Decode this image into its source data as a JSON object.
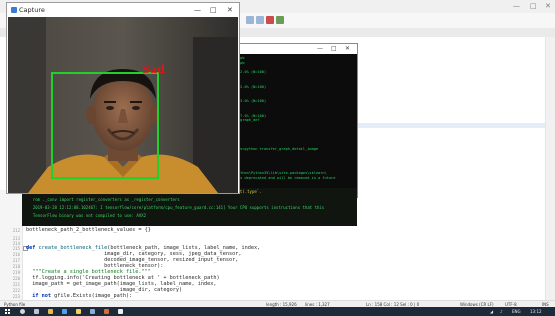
{
  "editor": {
    "window_controls": [
      "—",
      "□",
      "✕"
    ],
    "code_lines": [
      {
        "num": "212",
        "text": "bottleneck_path_2_bottleneck_values = {}"
      },
      {
        "num": "213",
        "text": ""
      },
      {
        "num": "214",
        "text": ""
      },
      {
        "num": "215",
        "kw": "def ",
        "fn": "create_bottleneck_file",
        "text": "(bottleneck_path, image_lists, label_name, index,"
      },
      {
        "num": "216",
        "text": "                         image_dir, category, sess, jpeg_data_tensor,"
      },
      {
        "num": "217",
        "text": "                         decoded_image_tensor, resized_input_tensor,"
      },
      {
        "num": "218",
        "text": "                         bottleneck_tensor):"
      },
      {
        "num": "219",
        "str": "  \"\"\"Create a single bottleneck file.\"\"\""
      },
      {
        "num": "220",
        "text": "  tf.logging.info('Creating bottleneck at ' + bottleneck_path)"
      },
      {
        "num": "221",
        "text": "  image_path = get_image_path(image_lists, label_name, index,"
      },
      {
        "num": "222",
        "text": "                              image_dir, category)"
      },
      {
        "num": "223",
        "kw": "  if not ",
        "text": "gfile.Exists(image_path):"
      }
    ]
  },
  "console": {
    "window_controls": [
      "—",
      "□",
      "✕"
    ],
    "lines": [
      ".pb",
      ".pb",
      "0",
      "52.0% (N=100)",
      "",
      "0",
      "62.0% (N=100)",
      "",
      "0",
      "63.0% (N=100)",
      "",
      "0",
      "77.0% (N=100)",
      "ngraph_def",
      "",
      "",
      "",
      "",
      "",
      "ws>python transfer_graph_detail_image",
      "",
      "",
      "",
      "",
      "ython\\Python35\\lib\\site-packages\\sklearn\\",
      "is deprecated and will be removed in a future",
      "",
      "",
      "",
      "",
      "",
      "",
      "",
      "label.py",
      "warnings: Conversion of the second argument of"
    ]
  },
  "output": {
    "lines": [
      "  floating` is deprecated. In future, it will be treated as `np.float64 == np.dtype(float).type`.",
      "  rom ._conv import register_converters as _register_converters",
      "  2019-03-28 12:12:08.102467: I tensorflow/core/platform/cpu_feature_guard.cc:141] Your CPU supports instructions that this",
      "  TensorFlow binary was not compiled to use: AVX2"
    ]
  },
  "capture": {
    "title": "Capture",
    "window_controls": [
      "—",
      "□",
      "✕"
    ],
    "emotion_label": "Sad"
  },
  "statusbar": {
    "left": "Python file",
    "length": "length : 15,926",
    "lines": "lines : 1,327",
    "position": "Ln : 158   Col : 12   Sel : 0 | 0",
    "eol": "Windows (CR LF)",
    "encoding": "UTF-8",
    "mode": "INS"
  },
  "taskbar": {
    "tray_text": "ENG",
    "time": "13:12"
  },
  "colors": {
    "detection_box": "#1fd12a",
    "emotion_label": "#e11414",
    "console_text": "#27d35f"
  },
  "icons": [
    "windows-start-icon",
    "search-icon",
    "task-view-icon",
    "file-explorer-icon",
    "browser-icon",
    "python-icon",
    "terminal-icon",
    "network-icon",
    "speaker-icon"
  ]
}
